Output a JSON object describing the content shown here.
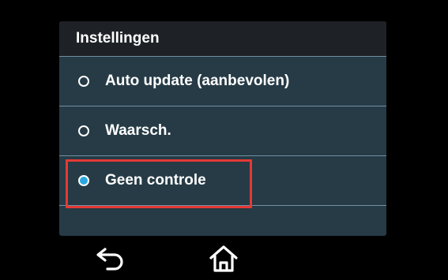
{
  "panel": {
    "title": "Instellingen"
  },
  "options": [
    {
      "label": "Auto update (aanbevolen)",
      "selected": false
    },
    {
      "label": "Waarsch.",
      "selected": false
    },
    {
      "label": "Geen controle",
      "selected": true
    }
  ],
  "navbar": {
    "back_icon": "back-arrow-icon",
    "home_icon": "home-icon"
  },
  "colors": {
    "background": "#000000",
    "panel": "#263b46",
    "header": "#1e2226",
    "divider": "#6f8fa3",
    "accent": "#2aa7de",
    "highlight": "#e53935"
  }
}
